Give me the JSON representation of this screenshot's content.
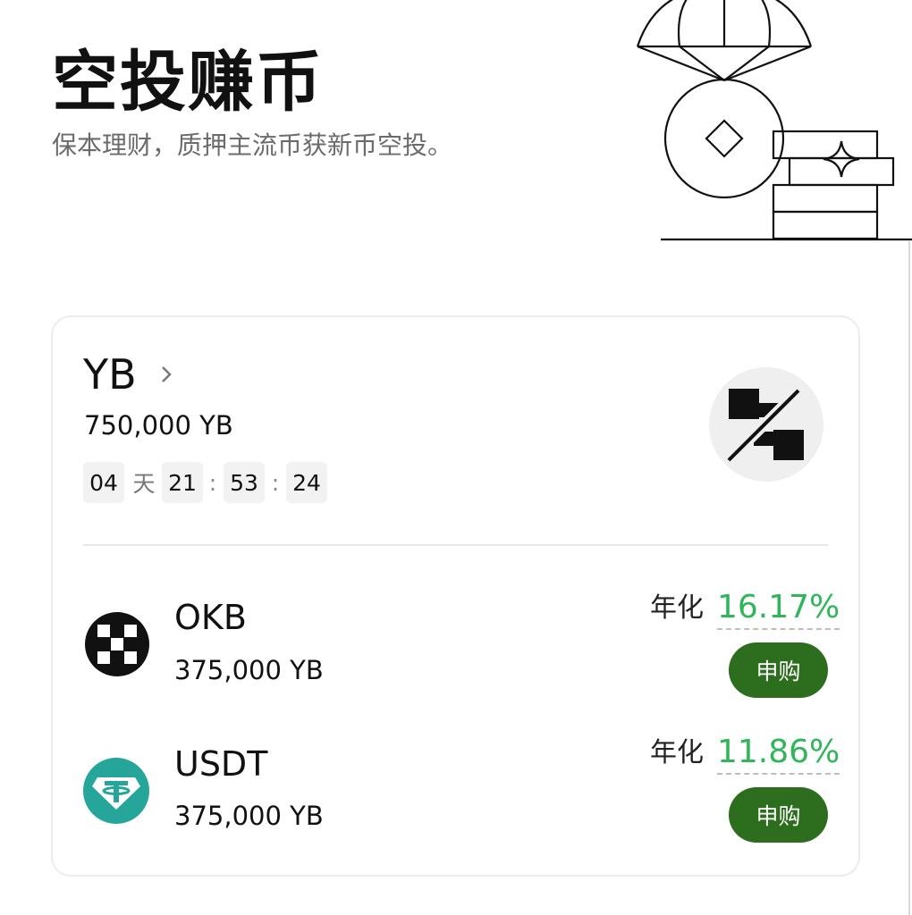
{
  "header": {
    "title": "空投赚币",
    "subtitle": "保本理财，质押主流币获新币空投。"
  },
  "project": {
    "name": "YB",
    "total_reward": "750,000 YB",
    "countdown": {
      "days": "04",
      "days_unit": "天",
      "hours": "21",
      "minutes": "53",
      "seconds": "24",
      "separator": ":"
    }
  },
  "pools": [
    {
      "token": "OKB",
      "amount": "375,000 YB",
      "apy_label": "年化",
      "apy_value": "16.17%",
      "button_label": "申购",
      "icon": "okb-logo-icon"
    },
    {
      "token": "USDT",
      "amount": "375,000 YB",
      "apy_label": "年化",
      "apy_value": "11.86%",
      "button_label": "申购",
      "icon": "usdt-logo-icon"
    }
  ],
  "colors": {
    "apy_green": "#2fb659",
    "button_green": "#2d6e1e",
    "usdt_teal": "#26a69a"
  }
}
